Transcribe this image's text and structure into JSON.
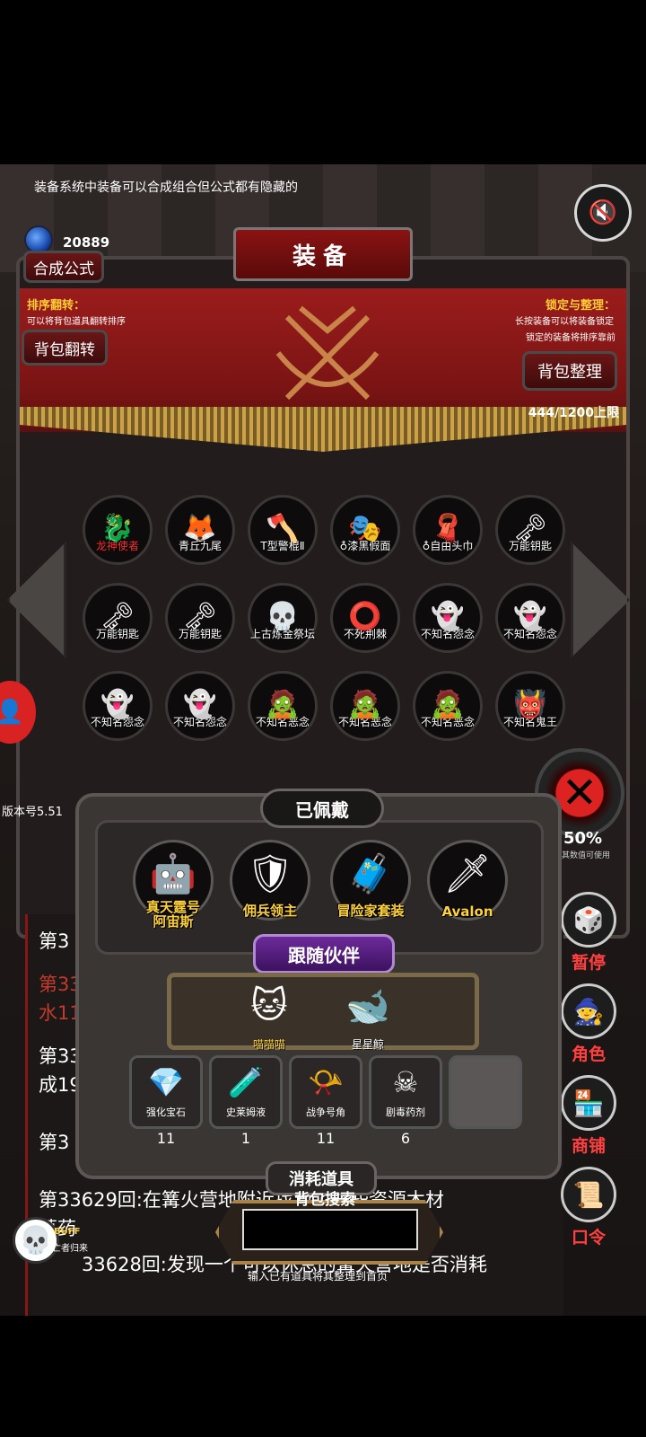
{
  "tip": "装备系统中装备可以合成组合但公式都有隐藏的",
  "currency": {
    "amount": "20889"
  },
  "panel": {
    "title": "装备",
    "formula_button": "合成公式",
    "sort_flip": {
      "heading": "排序翻转：",
      "desc": "可以将背包道具翻转排序",
      "button": "背包翻转"
    },
    "lock_sort": {
      "heading": "锁定与整理：",
      "desc1": "长按装备可以将装备锁定",
      "desc2": "锁定的装备将排序靠前",
      "button": "背包整理"
    },
    "capacity": "444/1200上限"
  },
  "items": [
    {
      "label": "龙神使者",
      "icon": "🐉",
      "red": true
    },
    {
      "label": "青丘九尾",
      "icon": "🦊",
      "red": false
    },
    {
      "label": "T型警棍Ⅱ",
      "icon": "🪓",
      "red": false
    },
    {
      "label": "♁漆黑假面",
      "icon": "🎭",
      "red": false
    },
    {
      "label": "♁自由头巾",
      "icon": "🧣",
      "red": false
    },
    {
      "label": "万能钥匙",
      "icon": "🗝",
      "red": false
    },
    {
      "label": "万能钥匙",
      "icon": "🗝",
      "red": false
    },
    {
      "label": "万能钥匙",
      "icon": "🗝",
      "red": false
    },
    {
      "label": "上古炼金祭坛",
      "icon": "💀",
      "red": false
    },
    {
      "label": "不死荆棘",
      "icon": "⭕",
      "red": false
    },
    {
      "label": "不知名怨念",
      "icon": "👻",
      "red": false
    },
    {
      "label": "不知名怨念",
      "icon": "👻",
      "red": false
    },
    {
      "label": "不知名怨念",
      "icon": "👻",
      "red": false
    },
    {
      "label": "不知名怨念",
      "icon": "👻",
      "red": false
    },
    {
      "label": "不知名恶念",
      "icon": "🧟",
      "red": false
    },
    {
      "label": "不知名恶念",
      "icon": "🧟",
      "red": false
    },
    {
      "label": "不知名恶念",
      "icon": "🧟",
      "red": false
    },
    {
      "label": "不知名鬼王",
      "icon": "👹",
      "red": false
    }
  ],
  "version": "版本号5.51",
  "log_lines": [
    "第3",
    "第33",
    "水11",
    "第33",
    "成19",
    "第3",
    "第33629回:在篝火营地附近找到了一些资源木材",
    "草药",
    "33628回:发现一个可以休息的篝火营地是否消耗"
  ],
  "pct": {
    "value": "50%",
    "sub": "其数值可使用"
  },
  "right_buttons": [
    {
      "label": "暂停",
      "icon": "🎲"
    },
    {
      "label": "角色",
      "icon": "🧙"
    },
    {
      "label": "商铺",
      "icon": "🏪"
    },
    {
      "label": "口令",
      "icon": "📜"
    }
  ],
  "equipped": {
    "title": "已佩戴",
    "items": [
      {
        "label": "真天霆号\n阿宙斯",
        "icon": "🤖"
      },
      {
        "label": "佣兵领主",
        "icon": "🛡"
      },
      {
        "label": "冒险家套装",
        "icon": "🧳"
      },
      {
        "label": "Avalon",
        "icon": "🗡"
      }
    ]
  },
  "companion": {
    "title": "跟随伙伴",
    "items": [
      {
        "label": "喵喵喵",
        "icon": "🐱"
      },
      {
        "label": "星星鲸",
        "icon": "🐋"
      }
    ]
  },
  "consumables": {
    "title": "消耗道具",
    "items": [
      {
        "label": "强化宝石",
        "icon": "💎",
        "count": "11"
      },
      {
        "label": "史莱姆液",
        "icon": "🧪",
        "count": "1"
      },
      {
        "label": "战争号角",
        "icon": "📯",
        "count": "11"
      },
      {
        "label": "剧毒药剂",
        "icon": "☠",
        "count": "6"
      }
    ]
  },
  "search": {
    "title": "背包搜索",
    "hint": "输入已有道具将其整理到首页"
  },
  "buff": {
    "label": "BUFF",
    "sub": "亡者归来"
  }
}
